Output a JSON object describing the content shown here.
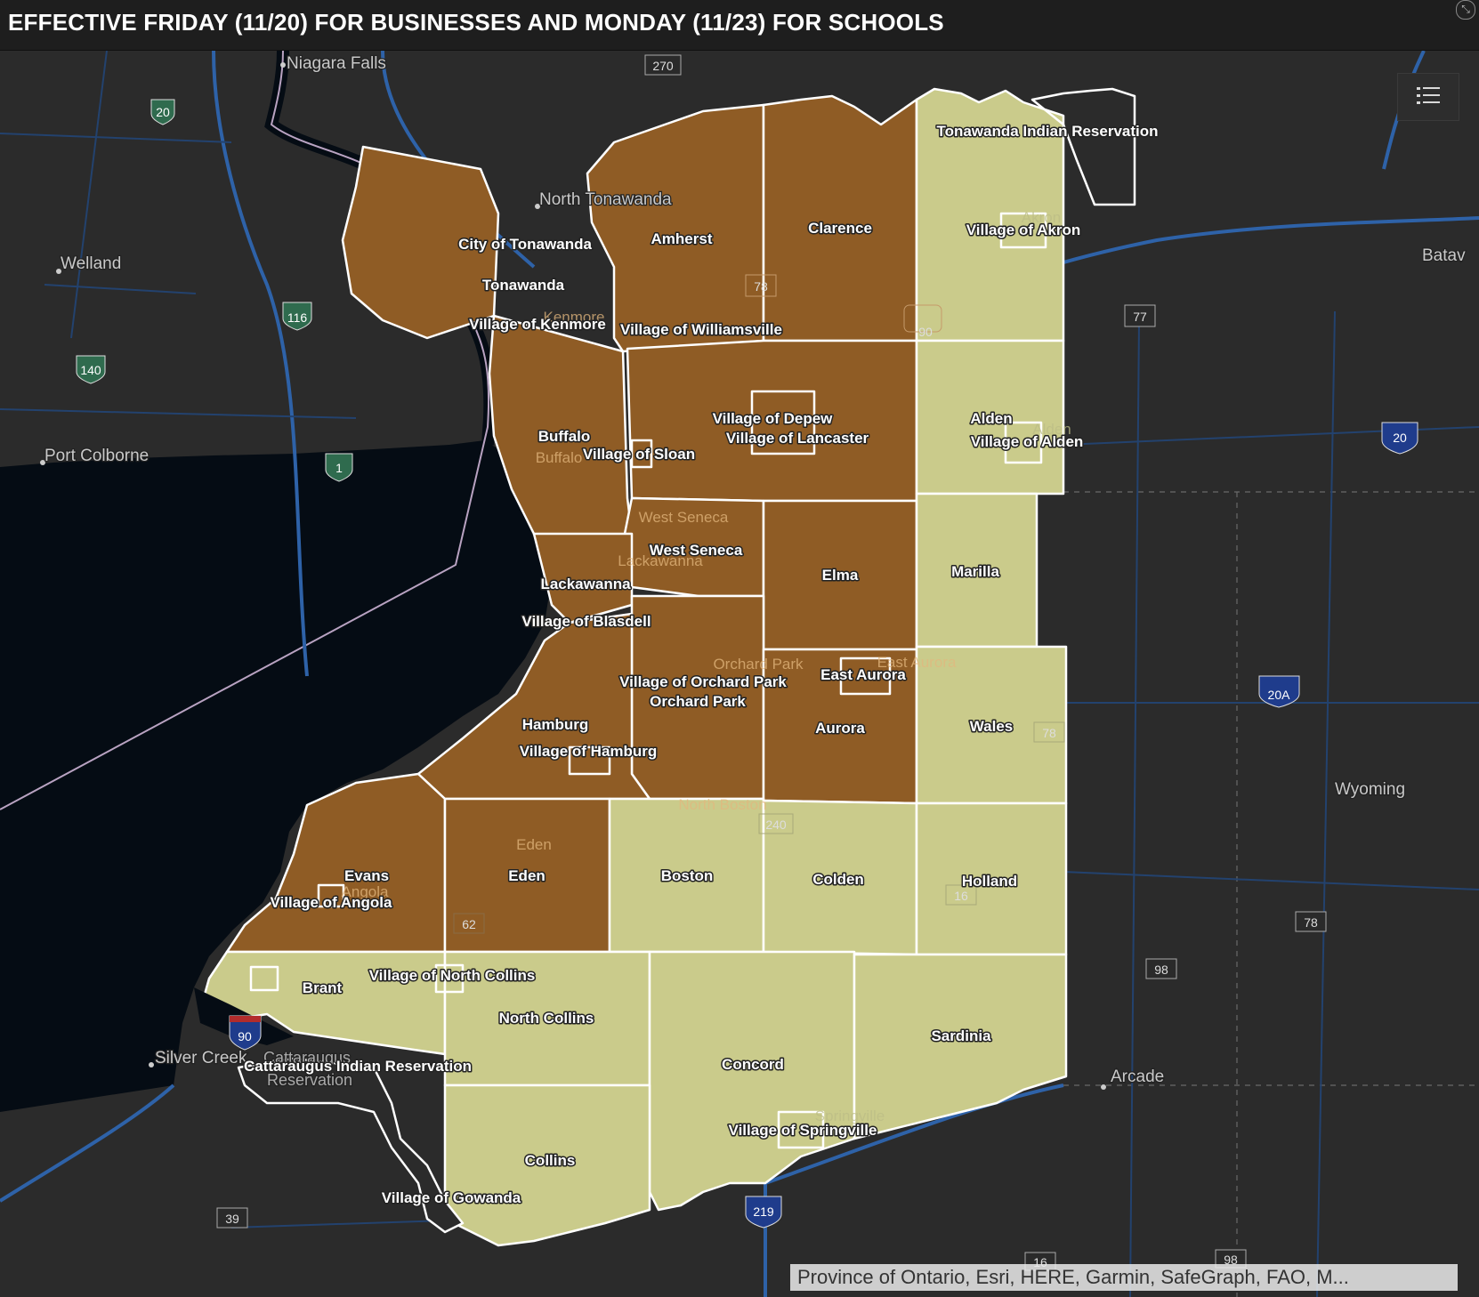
{
  "header": {
    "title": "EFFECTIVE FRIDAY (11/20) FOR BUSINESSES AND MONDAY (11/23) FOR SCHOOLS"
  },
  "colors": {
    "orange_zone": "#8f5c25",
    "yellow_zone": "#cacb8b",
    "water": "#050c14",
    "land": "#2b2b2b",
    "header_bg": "#1e1e1e",
    "highway": "#2e62a8"
  },
  "icons": {
    "legend": "list-icon",
    "expand": "arrow-expand-icon"
  },
  "places": {
    "niagara_falls": "Niagara Falls",
    "north_tonawanda": "North Tonawanda",
    "welland": "Welland",
    "port_colborne": "Port Colborne",
    "batavia": "Batav",
    "wyoming": "Wyoming",
    "arcade": "Arcade",
    "silver_creek": "Silver Creek",
    "cattaraugus": "Cattaraugus",
    "reservation": "Reservation"
  },
  "faint_labels": {
    "buffalo": "Buffalo",
    "west_seneca": "West Seneca",
    "lackawanna": "Lackawanna",
    "orchard_park": "Orchard Park",
    "east_aurora": "East Aurora",
    "north_boston": "North Boston",
    "eden": "Eden",
    "angola": "Angola",
    "alden": "Alden",
    "akron": "Akron",
    "kenmore": "Kenmore",
    "springville": "Springville"
  },
  "routes": {
    "r270": "270",
    "r20a_ont": "20",
    "r116": "116",
    "r140": "140",
    "r1": "1",
    "r78a": "78",
    "r90a": "90",
    "r77": "77",
    "r20": "20",
    "r20a": "20A",
    "r78b": "78",
    "r240": "240",
    "r16a": "16",
    "r62": "62",
    "r78c": "78",
    "r98a": "98",
    "r90b": "90",
    "r39": "39",
    "r219": "219",
    "r16b": "16",
    "r98b": "98"
  },
  "regions": {
    "tonawanda_indian_reservation": "Tonawanda Indian Reservation",
    "village_of_akron": "Village of Akron",
    "amherst": "Amherst",
    "clarence": "Clarence",
    "city_of_tonawanda": "City of Tonawanda",
    "tonawanda": "Tonawanda",
    "village_of_kenmore": "Village of Kenmore",
    "village_of_williamsville": "Village of Williamsville",
    "village_of_depew": "Village of Depew",
    "village_of_lancaster": "Village of Lancaster",
    "alden": "Alden",
    "village_of_alden": "Village of Alden",
    "buffalo": "Buffalo",
    "village_of_sloan": "Village of Sloan",
    "west_seneca": "West Seneca",
    "marilla": "Marilla",
    "elma": "Elma",
    "lackawanna": "Lackawanna",
    "village_of_blasdell": "Village of Blasdell",
    "east_aurora": "East Aurora",
    "village_of_orchard_park": "Village of Orchard Park",
    "orchard_park": "Orchard Park",
    "wales": "Wales",
    "aurora": "Aurora",
    "hamburg": "Hamburg",
    "village_of_hamburg": "Village of Hamburg",
    "evans": "Evans",
    "eden": "Eden",
    "boston": "Boston",
    "colden": "Colden",
    "holland": "Holland",
    "village_of_angola": "Village of Angola",
    "village_of_north_collins": "Village of North Collins",
    "brant": "Brant",
    "north_collins": "North Collins",
    "sardinia": "Sardinia",
    "concord": "Concord",
    "cattaraugus_indian_reservation": "Cattaraugus Indian Reservation",
    "village_of_springville": "Village of Springville",
    "collins": "Collins",
    "village_of_gowanda": "Village of Gowanda"
  },
  "attribution": "Province of Ontario, Esri, HERE, Garmin, SafeGraph, FAO, M..."
}
